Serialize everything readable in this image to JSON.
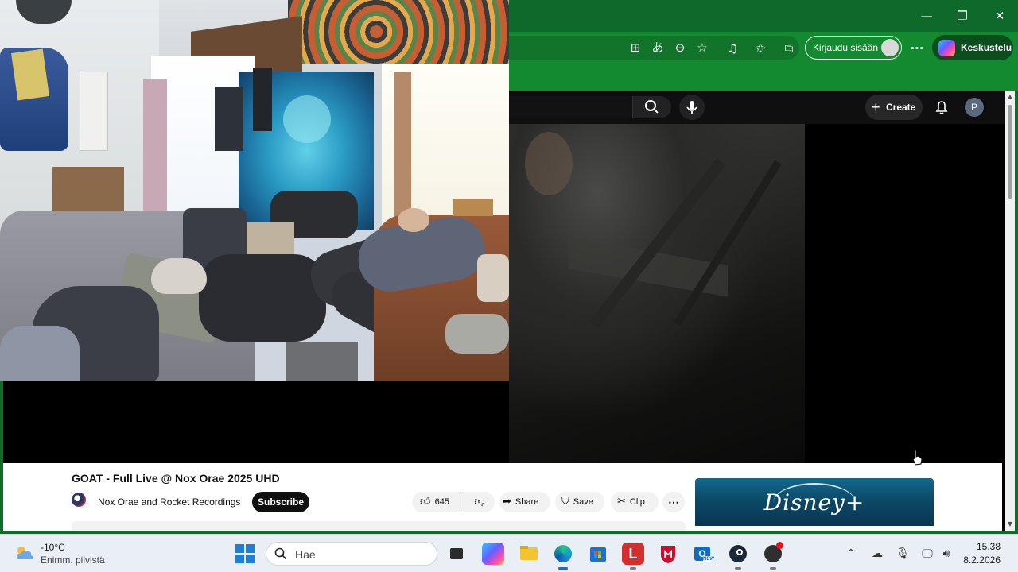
{
  "browser": {
    "window_controls": {
      "minimize": "—",
      "restore": "❐",
      "close": "✕"
    },
    "toolbar": {
      "sign_in_label": "Kirjaudu sisään",
      "copilot_label": "Keskustelu",
      "more_glyph": "···",
      "icons": [
        "apps-icon",
        "translate-icon",
        "zoom-out-icon",
        "favorite-star-icon",
        "media-control-icon",
        "favorites-icon",
        "collections-icon"
      ]
    },
    "accent_color": "#138a2f"
  },
  "youtube": {
    "header": {
      "create_label": "Create",
      "avatar_letter": "P"
    },
    "video": {
      "title": "GOAT - Full Live @ Nox Orae 2025 UHD",
      "channel": "Nox Orae and Rocket Recordings",
      "subscribe_label": "Subscribe",
      "likes": "645",
      "share_label": "Share",
      "save_label": "Save",
      "clip_label": "Clip",
      "more_glyph": "⋯"
    },
    "ad": {
      "logo_text": "Disney+"
    }
  },
  "taskbar": {
    "weather": {
      "temp": "-10°C",
      "desc": "Enimm. pilvistä"
    },
    "search_placeholder": "Hae",
    "pinned_apps": [
      "task-view",
      "copilot",
      "file-explorer",
      "edge",
      "microsoft-store",
      "lastpass",
      "mcafee",
      "outlook-new",
      "steam",
      "obs-studio"
    ],
    "clock": {
      "time": "15.38",
      "date": "8.2.2026"
    }
  }
}
